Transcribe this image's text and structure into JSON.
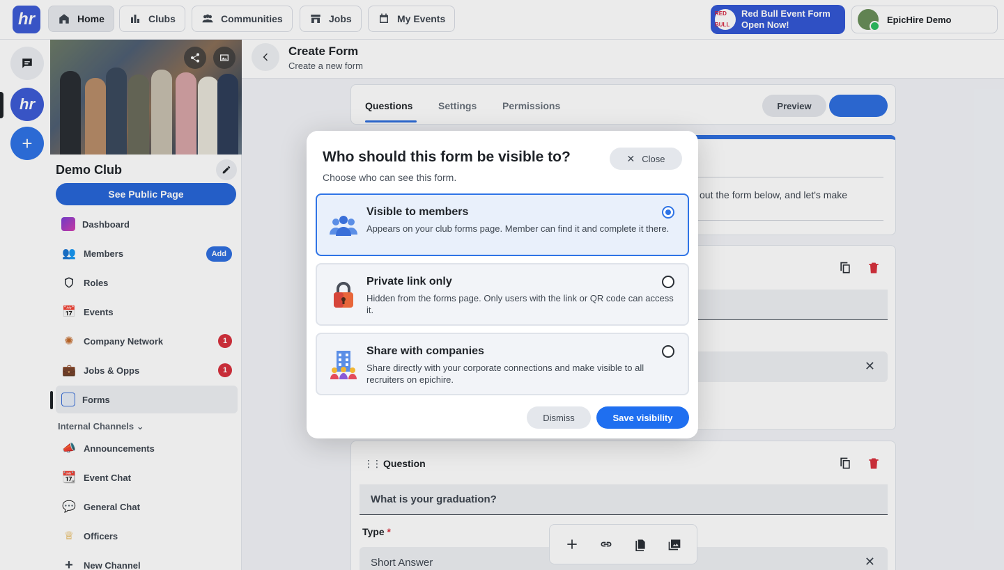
{
  "topbar": {
    "nav": [
      "Home",
      "Clubs",
      "Communities",
      "Jobs",
      "My Events"
    ],
    "promo_line1": "Red Bull Event Form",
    "promo_line2": "Open Now!",
    "user_name": "EpicHire Demo",
    "logo_text": "hr"
  },
  "sidebar": {
    "club_name": "Demo Club",
    "public_btn": "See Public Page",
    "items": [
      {
        "label": "Dashboard",
        "icon": "dashboard-icon"
      },
      {
        "label": "Members",
        "icon": "members-icon",
        "badge": "Add"
      },
      {
        "label": "Roles",
        "icon": "shield-icon"
      },
      {
        "label": "Events",
        "icon": "calendar-icon"
      },
      {
        "label": "Company Network",
        "icon": "network-icon",
        "badge": "1"
      },
      {
        "label": "Jobs & Opps",
        "icon": "jobs-icon",
        "badge": "1"
      },
      {
        "label": "Forms",
        "icon": "forms-icon"
      }
    ],
    "section": "Internal Channels",
    "channels": [
      {
        "label": "Announcements",
        "icon": "megaphone-icon"
      },
      {
        "label": "Event Chat",
        "icon": "calendar-icon"
      },
      {
        "label": "General Chat",
        "icon": "speech-bubble-icon"
      },
      {
        "label": "Officers",
        "icon": "crown-icon"
      },
      {
        "label": "New Channel",
        "icon": "plus-icon"
      }
    ]
  },
  "main": {
    "title": "Create Form",
    "subtitle": "Create a new form",
    "tabs": [
      "Questions",
      "Settings",
      "Permissions"
    ],
    "preview": "Preview",
    "intro_text": "out the form below, and let's make",
    "q2_label": "Question",
    "q2_value": "What is your graduation?",
    "type_label": "Type",
    "type_required": "*",
    "type_value": "Short Answer"
  },
  "modal": {
    "title": "Who should this form be visible to?",
    "subtitle": "Choose who can see this form.",
    "close": "Close",
    "options": [
      {
        "title": "Visible to members",
        "desc": "Appears on your club forms page. Member can find it and complete it there.",
        "selected": true,
        "icon": "members-group-icon"
      },
      {
        "title": "Private link only",
        "desc": "Hidden from the forms page. Only users with the link or QR code can access it.",
        "selected": false,
        "icon": "padlock-icon"
      },
      {
        "title": "Share with companies",
        "desc": "Share directly with your corporate connections and make visible to all recruiters on epichire.",
        "selected": false,
        "icon": "office-building-icon"
      }
    ],
    "dismiss": "Dismiss",
    "save": "Save visibility"
  },
  "colors": {
    "accent": "#2f74e6",
    "brand": "#3d5cd6",
    "danger": "#d8313d"
  }
}
